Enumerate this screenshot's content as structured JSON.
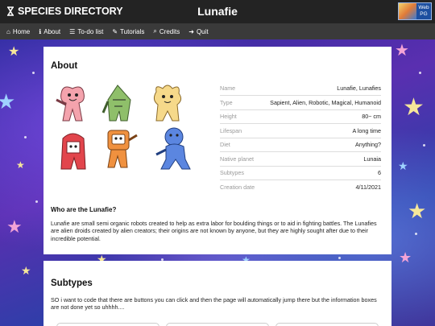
{
  "topbar": {
    "brand": "SPECIES DIRECTORY",
    "brand_icon": "hourglass-icon",
    "page_title": "Lunafie",
    "rating_badge": "Web PG"
  },
  "nav": [
    {
      "label": "Home",
      "icon": "home-icon",
      "glyph": "⌂"
    },
    {
      "label": "About",
      "icon": "info-icon",
      "glyph": "ℹ"
    },
    {
      "label": "To-do list",
      "icon": "list-icon",
      "glyph": "☰"
    },
    {
      "label": "Tutorials",
      "icon": "wand-icon",
      "glyph": "✎"
    },
    {
      "label": "Credits",
      "icon": "search-icon",
      "glyph": "⌕"
    },
    {
      "label": "Quit",
      "icon": "arrow-circle-icon",
      "glyph": "➜"
    }
  ],
  "about": {
    "heading": "About",
    "info": [
      {
        "key": "Name",
        "value": "Lunafie, Lunafies"
      },
      {
        "key": "Type",
        "value": "Sapient, Alien, Robotic, Magical, Humanoid"
      },
      {
        "key": "Height",
        "value": "80~ cm"
      },
      {
        "key": "Lifespan",
        "value": "A long time"
      },
      {
        "key": "Diet",
        "value": "Anything?"
      },
      {
        "key": "Native planet",
        "value": "Lunaia"
      },
      {
        "key": "Subtypes",
        "value": "6"
      },
      {
        "key": "Creation date",
        "value": "4/11/2021"
      }
    ],
    "who_heading": "Who are the Lunafie?",
    "who_text": "Lunafie are small semi organic robots created to help as extra labor for boulding things or to aid in fighting battles. The Lunafies are alien droids created by alien creators; their origins are not known by anyone, but they are highly sought after due to their incredible potential.",
    "characters": [
      {
        "icon": "lunafie-pink-icon",
        "color": "#f4a3ad"
      },
      {
        "icon": "lunafie-green-icon",
        "color": "#8fbf6a"
      },
      {
        "icon": "lunafie-yellow-icon",
        "color": "#f6d98a"
      },
      {
        "icon": "lunafie-red-icon",
        "color": "#e2454c"
      },
      {
        "icon": "lunafie-orange-icon",
        "color": "#f0913f"
      },
      {
        "icon": "lunafie-blue-icon",
        "color": "#5b86e0"
      }
    ]
  },
  "subtypes": {
    "heading": "Subtypes",
    "text": "SO i want to code that there are buttons you can click and then the page will automatically jump there but the information boxes are not done yet so uhhhh...."
  }
}
